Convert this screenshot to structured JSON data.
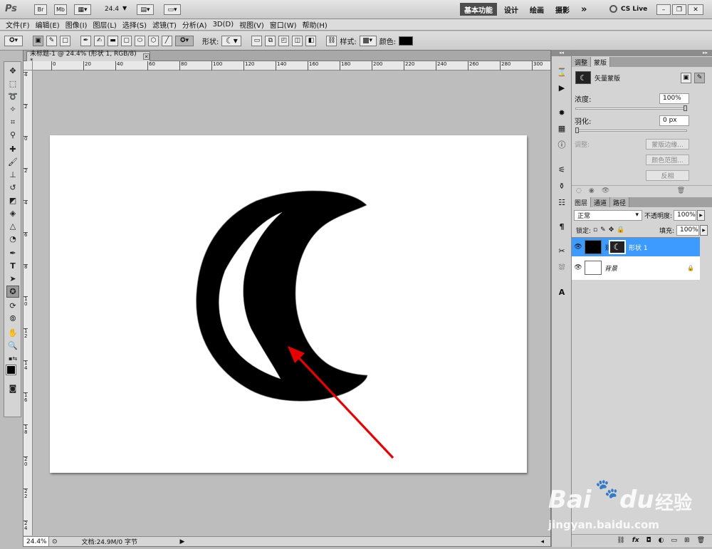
{
  "app": {
    "logo": "Ps"
  },
  "appbar": {
    "br": "Br",
    "mb": "Mb",
    "zoom": "24.4",
    "workspaces": [
      "基本功能",
      "设计",
      "绘画",
      "摄影"
    ],
    "more": "»",
    "cslive": "CS Live"
  },
  "menu": [
    "文件(F)",
    "编辑(E)",
    "图像(I)",
    "图层(L)",
    "选择(S)",
    "滤镜(T)",
    "分析(A)",
    "3D(D)",
    "视图(V)",
    "窗口(W)",
    "帮助(H)"
  ],
  "options": {
    "shape_label": "形状:",
    "style_label": "样式:",
    "color_label": "颜色:",
    "color": "#000000"
  },
  "document": {
    "tab_title": "未标题-1 @ 24.4% (形状 1, RGB/8) *",
    "h_ticks": [
      "0",
      "20",
      "40",
      "60",
      "80",
      "100",
      "120",
      "140",
      "160",
      "180",
      "200",
      "220",
      "240",
      "260",
      "280",
      "300"
    ],
    "v_ticks": [
      "4",
      "2",
      "0",
      "2",
      "4",
      "6",
      "8",
      "10",
      "12",
      "14",
      "16",
      "18",
      "20",
      "22",
      "24"
    ]
  },
  "status": {
    "zoom": "24.4%",
    "doc": "文档:24.9M/0 字节"
  },
  "adjust_panel": {
    "tabs": [
      "调整",
      "蒙版"
    ],
    "mask_title": "矢量蒙版",
    "density_label": "浓度:",
    "density": "100%",
    "feather_label": "羽化:",
    "feather": "0 px",
    "refine_label": "调整:",
    "buttons": [
      "蒙版边缘...",
      "颜色范围...",
      "反相"
    ]
  },
  "layers_panel": {
    "tabs": [
      "图层",
      "通道",
      "路径"
    ],
    "blend_mode": "正常",
    "opacity_label": "不透明度:",
    "opacity": "100%",
    "lock_label": "锁定:",
    "fill_label": "填充:",
    "fill": "100%",
    "layers": [
      {
        "name": "形状 1",
        "selected": true
      },
      {
        "name": "背景",
        "selected": false
      }
    ]
  },
  "watermark": {
    "brand": "Bai",
    "paw": "du",
    "cn": "经验",
    "url": "jingyan.baidu.com"
  }
}
